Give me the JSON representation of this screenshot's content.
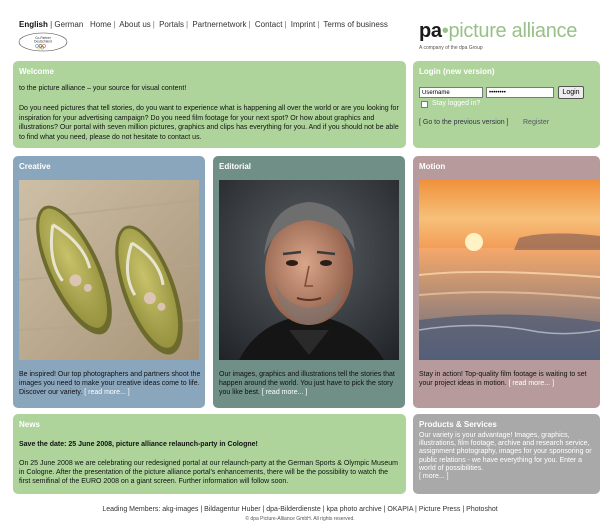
{
  "header": {
    "lang_active": "English",
    "lang_other": "German",
    "nav": [
      "Home",
      "About us",
      "Portals",
      "Partnernetwork",
      "Contact",
      "Imprint",
      "Terms of business"
    ],
    "partner_logo": {
      "line1": "Co-Partner",
      "line2": "Deutschland"
    },
    "brand_pa": "pa",
    "brand_rest": "picture alliance",
    "brand_sub": "A company of the dpa Group"
  },
  "welcome": {
    "title": "Welcome",
    "intro": "to the picture alliance – your source for visual content!",
    "body": "Do you need pictures that tell stories, do you want to experience what is happening all over the world or are you looking for inspiration for your advertising campaign? Do you need film footage for your next spot? Or how about graphics and illustrations? Our portal with seven million pictures, graphics and clips has everything for you. And if you should not be able to find what you need, please do not hesitate to contact us."
  },
  "login": {
    "title": "Login (new version)",
    "username_value": "Username",
    "password_value": "••••••••",
    "button": "Login",
    "stay": "Stay logged in?",
    "prev": "[ Go to the previous version ]",
    "register": "Register"
  },
  "creative": {
    "title": "Creative",
    "text": "Be inspired! Our top photographers and partners shoot the images you need to make your creative ideas come to life. Discover our variety.",
    "more": "[ read more... ]"
  },
  "editorial": {
    "title": "Editorial",
    "text": "Our images, graphics and illustrations tell the stories that happen around the world. You just have to pick the story you like best.",
    "more": "[ read more... ]"
  },
  "motion": {
    "title": "Motion",
    "text": "Stay in action! Top-quality film footage is waiting to set your project ideas in motion.",
    "more": "[ read more... ]"
  },
  "news": {
    "title": "News",
    "headline": "Save the date: 25 June 2008, picture alliance relaunch-party in Cologne!",
    "body": "On 25 June 2008 we are celebrating our redesigned portal at our relaunch-party at the German Sports & Olympic Museum in Cologne. After the presentation of the picture alliance portal's enhancements, there will be the possibility to watch the first semifinal of the EURO 2008 on a giant screen. Further information will follow soon."
  },
  "products": {
    "title": "Products & Services",
    "body": "Our variety is your advantage! Images, graphics, illustrations, film footage, archive and research service, assignment photography, images for your sponsoring or public relations - we have everything for you. Enter a world of possibilities.",
    "more": "[ more... ]"
  },
  "footer": {
    "label": "Leading Members:",
    "members": "akg-images | Bildagentur Huber | dpa-Bilderdienste | kpa photo archive | OKAPIA | Picture Press | Photoshot",
    "copyright": "© dpa Picture-Alliance GmbH. All rights reserved."
  }
}
